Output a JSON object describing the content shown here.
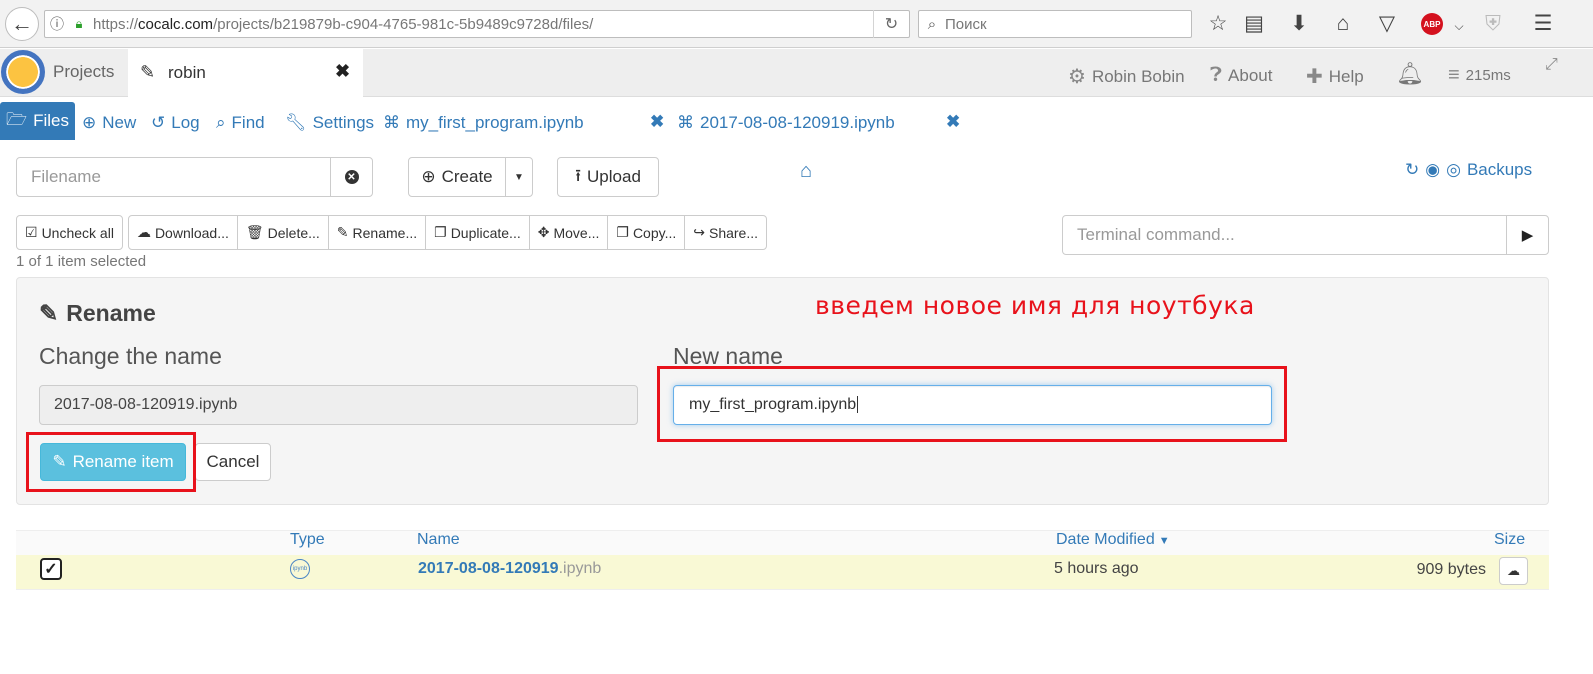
{
  "browser": {
    "url_prefix": "https://",
    "url_host": "cocalc.com",
    "url_path": "/projects/b219879b-c904-4765-981c-5b9489c9728d/files/",
    "search_placeholder": "Поиск",
    "abp_label": "ABP"
  },
  "topnav": {
    "projects_label": "Projects",
    "project_tab_name": "robin",
    "user_name": "Robin Bobin",
    "about_label": "About",
    "help_label": "Help",
    "ping": "215ms"
  },
  "tabs": {
    "files": "Files",
    "new": "New",
    "log": "Log",
    "find": "Find",
    "settings": "Settings",
    "open_files": [
      "my_first_program.ipynb",
      "2017-08-08-120919.ipynb"
    ]
  },
  "controls": {
    "filename_placeholder": "Filename",
    "create_label": "Create",
    "upload_label": "Upload",
    "backups_label": "Backups",
    "terminal_placeholder": "Terminal command..."
  },
  "actions": {
    "uncheck_all": "Uncheck all",
    "download": "Download...",
    "delete": "Delete...",
    "rename": "Rename...",
    "duplicate": "Duplicate...",
    "move": "Move...",
    "copy": "Copy...",
    "share": "Share...",
    "selected_text": "1 of 1 item selected"
  },
  "rename_panel": {
    "title": "Rename",
    "change_label": "Change the name",
    "new_label": "New name",
    "old_value": "2017-08-08-120919.ipynb",
    "new_value": "my_first_program.ipynb",
    "rename_button": "Rename item",
    "cancel_button": "Cancel"
  },
  "annotation": "введем новое имя для ноутбука",
  "listing": {
    "headers": {
      "type": "Type",
      "name": "Name",
      "date": "Date Modified",
      "size": "Size"
    },
    "rows": [
      {
        "name_base": "2017-08-08-120919",
        "name_ext": ".ipynb",
        "type_icon": "ipynb",
        "date": "5 hours ago",
        "size": "909 bytes",
        "checked": true
      }
    ]
  },
  "colors": {
    "link": "#337ab7",
    "annotation_red": "#e8121b",
    "info_button": "#5bc0de",
    "selected_row": "#f9f9d5"
  }
}
